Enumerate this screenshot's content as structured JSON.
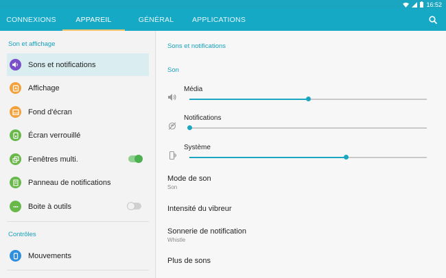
{
  "statusbar": {
    "time": "16:52"
  },
  "tabs": [
    {
      "label": "CONNEXIONS",
      "active": false
    },
    {
      "label": "APPAREIL",
      "active": true
    },
    {
      "label": "GÉNÉRAL",
      "active": false
    },
    {
      "label": "APPLICATIONS",
      "active": false
    }
  ],
  "left": {
    "section1": "Son et affichage",
    "items": [
      {
        "label": "Sons et notifications",
        "icon": "speaker-icon",
        "color": "#7b4fc9"
      },
      {
        "label": "Affichage",
        "icon": "display-icon",
        "color": "#f2a23c"
      },
      {
        "label": "Fond d'écran",
        "icon": "wallpaper-icon",
        "color": "#f2a23c"
      },
      {
        "label": "Écran verrouillé",
        "icon": "lock-screen-icon",
        "color": "#68b94a"
      },
      {
        "label": "Fenêtres multi.",
        "icon": "multi-window-icon",
        "color": "#68b94a",
        "toggle": true
      },
      {
        "label": "Panneau de notifications",
        "icon": "notification-panel-icon",
        "color": "#68b94a"
      },
      {
        "label": "Boite à outils",
        "icon": "toolbox-icon",
        "color": "#68b94a",
        "toggle": false
      }
    ],
    "section2": "Contrôles",
    "items2": [
      {
        "label": "Mouvements",
        "icon": "motion-icon",
        "color": "#2f8fdd"
      }
    ]
  },
  "right": {
    "title": "Sons et notifications",
    "son_header": "Son",
    "sliders": [
      {
        "label": "Média",
        "icon": "volume-icon",
        "level": 0.5
      },
      {
        "label": "Notifications",
        "icon": "notification-muted-icon",
        "level": 0.0
      },
      {
        "label": "Système",
        "icon": "system-vibrate-icon",
        "level": 0.66
      }
    ],
    "settings": [
      {
        "title": "Mode de son",
        "subtitle": "Son"
      },
      {
        "title": "Intensité du vibreur",
        "subtitle": ""
      },
      {
        "title": "Sonnerie de notification",
        "subtitle": "Whistle"
      },
      {
        "title": "Plus de sons",
        "subtitle": ""
      }
    ]
  },
  "colors": {
    "accent": "#16a9c6",
    "tab_indicator": "#f1c56a",
    "toggle_on": "#4caf50"
  }
}
